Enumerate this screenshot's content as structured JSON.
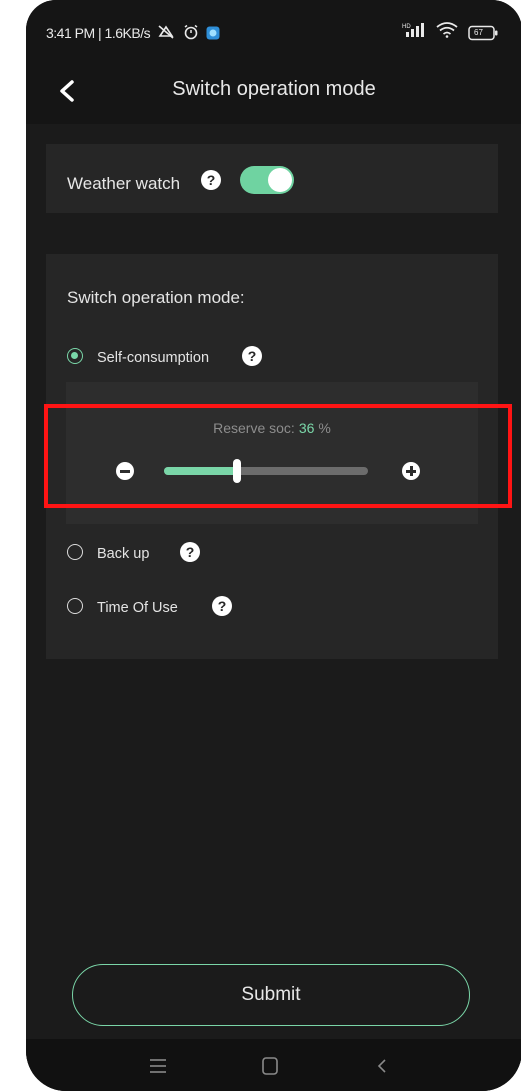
{
  "status_bar": {
    "time_speed": "3:41 PM | 1.6KB/s",
    "battery_level": "67"
  },
  "header": {
    "title": "Switch operation mode",
    "back_icon": "chevron-left-icon"
  },
  "weather_watch": {
    "label": "Weather watch",
    "enabled": true
  },
  "mode_section": {
    "title": "Switch operation mode:",
    "options": [
      {
        "label": "Self-consumption",
        "selected": true
      },
      {
        "label": "Back up",
        "selected": false
      },
      {
        "label": "Time Of Use",
        "selected": false
      }
    ],
    "reserve_soc": {
      "label": "Reserve soc:",
      "value": "36",
      "unit": "%",
      "fraction": 0.36
    }
  },
  "submit_label": "Submit",
  "colors": {
    "accent": "#7ad6a8",
    "background": "#1b1b1b",
    "card": "#262626",
    "highlight": "#ff1414"
  },
  "navbar": {
    "icons": [
      "menu-icon",
      "home-icon",
      "back-icon"
    ]
  }
}
